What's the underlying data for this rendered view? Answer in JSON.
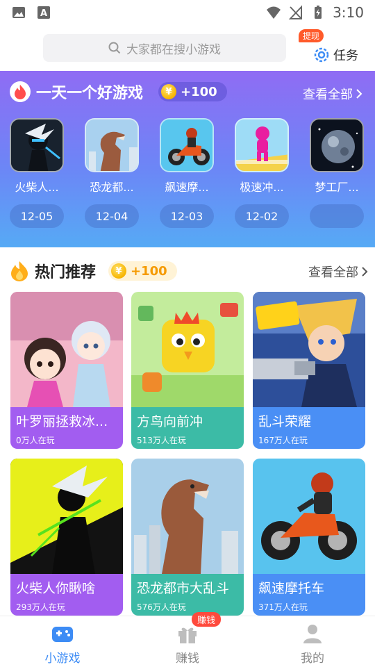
{
  "status_bar": {
    "time": "3:10"
  },
  "search": {
    "placeholder": "大家都在搜小游戏"
  },
  "task": {
    "badge": "提现",
    "label": "任务"
  },
  "daily": {
    "title": "一天一个好游戏",
    "coins": "+100",
    "view_all": "查看全部",
    "games": [
      {
        "name": "火柴人...",
        "date": "12-05"
      },
      {
        "name": "恐龙都...",
        "date": "12-04"
      },
      {
        "name": "飙速摩...",
        "date": "12-03"
      },
      {
        "name": "极速冲...",
        "date": "12-02"
      },
      {
        "name": "梦工厂...",
        "date": ""
      }
    ]
  },
  "hot": {
    "title": "热门推荐",
    "coins": "+100",
    "view_all": "查看全部",
    "cards": [
      {
        "name": "叶罗丽拯救冰...",
        "players": "0万人在玩",
        "color": "#a25df0"
      },
      {
        "name": "方鸟向前冲",
        "players": "513万人在玩",
        "color": "#3cbba6"
      },
      {
        "name": "乱斗荣耀",
        "players": "167万人在玩",
        "color": "#4a8ff5"
      },
      {
        "name": "火柴人你瞅啥",
        "players": "293万人在玩",
        "color": "#a25df0"
      },
      {
        "name": "恐龙都市大乱斗",
        "players": "576万人在玩",
        "color": "#3cbba6"
      },
      {
        "name": "飙速摩托车",
        "players": "371万人在玩",
        "color": "#4a8ff5"
      }
    ]
  },
  "nav": {
    "earn_badge": "赚钱",
    "items": [
      {
        "label": "小游戏"
      },
      {
        "label": "赚钱"
      },
      {
        "label": "我的"
      }
    ]
  }
}
